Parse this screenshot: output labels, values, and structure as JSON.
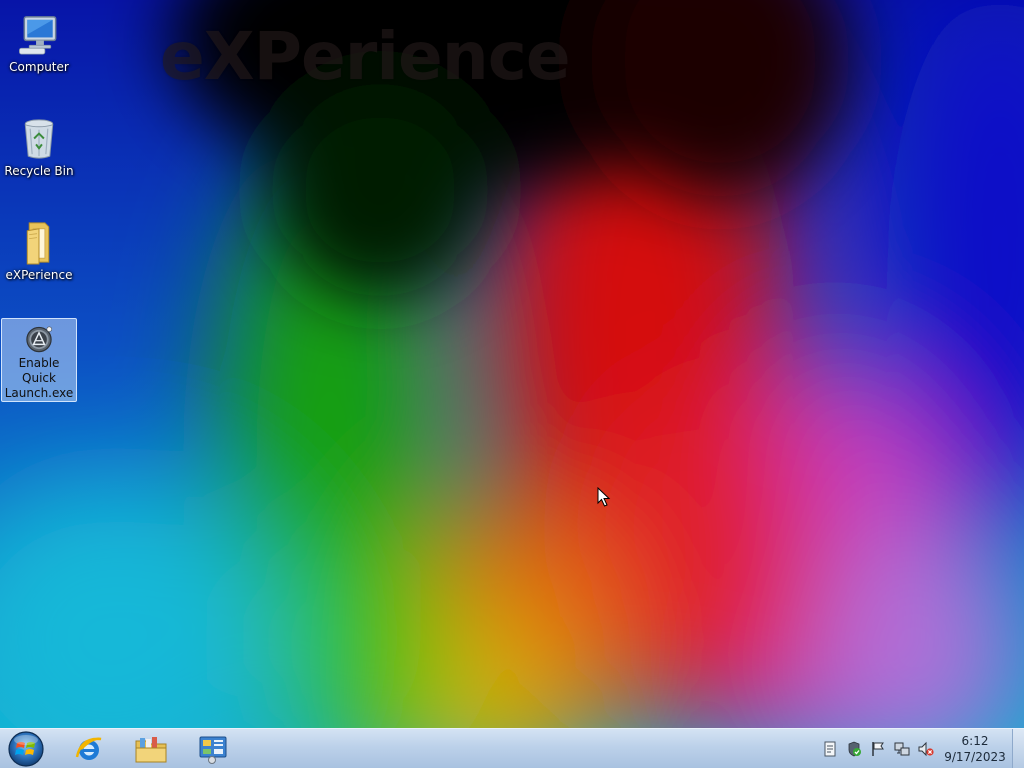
{
  "wallpaper": {
    "title": "eXPerience"
  },
  "desktop_icons": [
    {
      "label": "Computer",
      "icon": "computer-icon"
    },
    {
      "label": "Recycle Bin",
      "icon": "recycle-bin-icon"
    },
    {
      "label": "eXPerience",
      "icon": "folder-icon"
    },
    {
      "label": "Enable Quick Launch.exe",
      "icon": "aimp-app-icon",
      "selected": true
    }
  ],
  "taskbar": {
    "start_icon": "windows-start-orb-icon",
    "pinned": [
      {
        "name": "internet-explorer",
        "icon": "internet-explorer-icon"
      },
      {
        "name": "windows-explorer",
        "icon": "folder-library-icon"
      },
      {
        "name": "control-panel",
        "icon": "control-panel-icon"
      }
    ],
    "tray_icons": [
      "document-icon",
      "security-shield-icon",
      "action-center-flag-icon",
      "network-icon",
      "volume-muted-icon"
    ],
    "clock": {
      "time": "6:12",
      "date": "9/17/2023"
    }
  },
  "colors": {
    "taskbar_top": "#d4e3f3",
    "taskbar_bottom": "#a9c2e0",
    "selection": "#bed7f5"
  }
}
